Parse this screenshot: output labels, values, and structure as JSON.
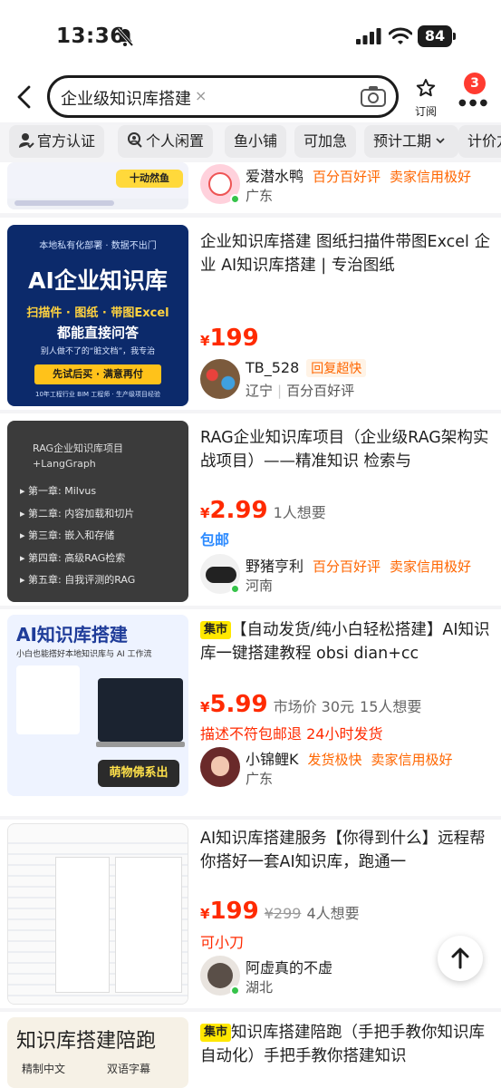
{
  "status": {
    "time": "13:36",
    "battery": "84"
  },
  "search": {
    "query": "企业级知识库搭建",
    "clear": "×"
  },
  "header": {
    "subscribe_label": "订阅",
    "badge_count": "3"
  },
  "filters": [
    "官方认证",
    "个人闲置",
    "鱼小铺",
    "可加急",
    "预计工期",
    "计价方"
  ],
  "items": [
    {
      "seller": "爱潜水鸭",
      "tags": [
        "百分百好评",
        "卖家信用极好"
      ],
      "location": "广东",
      "thumb_text": "十动然鱼"
    },
    {
      "title": "企业知识库搭建 图纸扫描件带图Excel 企业 AI知识库搭建 | 专治图纸",
      "price_symbol": "¥",
      "price": "199",
      "seller": "TB_528",
      "seller_tag": "回复超快",
      "location": "辽宁",
      "loc_tag": "百分百好评",
      "thumb": {
        "top": "本地私有化部署 · 数据不出门",
        "title": "AI企业知识库",
        "line1": "扫描件 · 图纸 · 带图Excel",
        "line2": "都能直接问答",
        "line3": "别人做不了的“脏文档”，我专治",
        "btn": "先试后买 · 满意再付",
        "foot": "10年工程行业 BIM 工程师 · 生产级项目经验"
      }
    },
    {
      "title": "RAG企业知识库项目（企业级RAG架构实战项目）——精准知识 检索与",
      "price_symbol": "¥",
      "price": "2.99",
      "want": "1人想要",
      "extra": "包邮",
      "seller": "野猪亨利",
      "tags": [
        "百分百好评",
        "卖家信用极好"
      ],
      "location": "河南",
      "thumb": {
        "head": "RAG企业知识库项目 +LangGraph",
        "chapters": [
          "第一章: Milvus",
          "第二章: 内容加载和切片",
          "第三章: 嵌入和存储",
          "第四章: 高级RAG检索",
          "第五章: 自我评测的RAG"
        ]
      }
    },
    {
      "badge": "集市",
      "title": "【自动发货/纯小白轻松搭建】AI知识库一键搭建教程 obsi dian+cc",
      "price_symbol": "¥",
      "price": "5.99",
      "market": "市场价 30元",
      "want": "15人想要",
      "extra": "描述不符包邮退  24小时发货",
      "seller": "小锦鲤K",
      "tags": [
        "发货极快",
        "卖家信用极好"
      ],
      "location": "广东",
      "thumb": {
        "title": "AI知识库搭建",
        "sub": "小白也能搭好本地知识库与 AI 工作流",
        "cta": "萌物佛系出"
      }
    },
    {
      "title": "AI知识库搭建服务【你得到什么】远程帮你搭好一套AI知识库，跑通一",
      "price_symbol": "¥",
      "price": "199",
      "old_price": "¥299",
      "want": "4人想要",
      "extra": "可小刀",
      "seller": "阿虚真的不虚",
      "location": "湖北"
    },
    {
      "badge": "集市",
      "title": "知识库搭建陪跑（手把手教你知识库自动化）手把手教你搭建知识",
      "thumb": {
        "title": "知识库搭建陪跑",
        "a": "精制中文",
        "b": "双语字幕"
      }
    }
  ],
  "colors": {
    "price": "#ff2a00",
    "tag": "#ff6600",
    "accent_blue": "#2f8cff",
    "market_badge": "#ffe800"
  }
}
